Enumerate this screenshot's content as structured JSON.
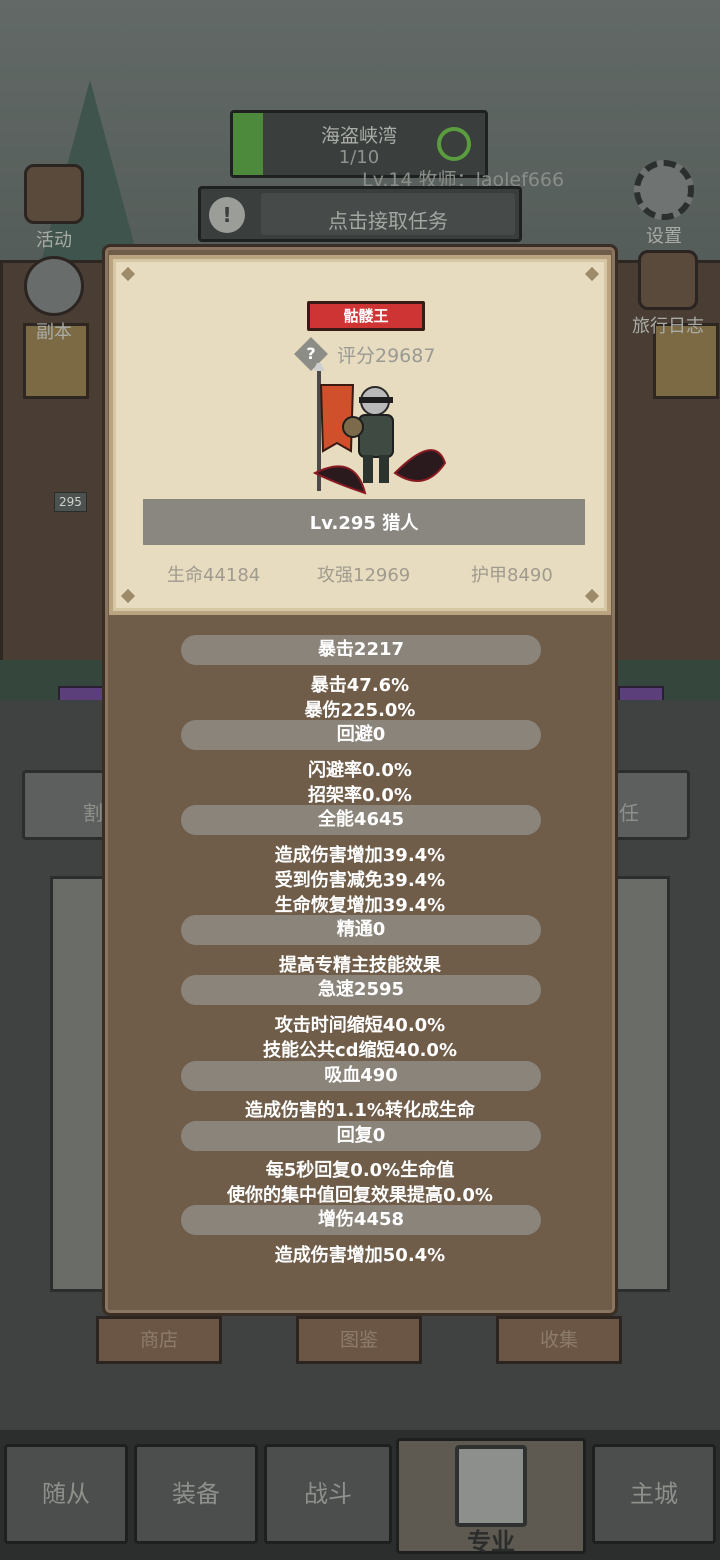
{
  "hud": {
    "quest_title": "海盗峡湾",
    "quest_count": "1/10",
    "player_info": "Lv.14 牧师：laolef666",
    "accept_task": "点击接取任务",
    "side_left": [
      "活动",
      "副本"
    ],
    "side_right": [
      "设置",
      "旅行日志"
    ],
    "small_level": "295"
  },
  "card": {
    "name": "骷髅王",
    "score": "评分29687",
    "level_class": "Lv.295 猎人",
    "hp": "生命44184",
    "attack": "攻强12969",
    "armor": "护甲8490"
  },
  "stats": {
    "crit": "暴击2217",
    "crit_rate": "暴击47.6%",
    "crit_dmg": "暴伤225.0%",
    "evade": "回避0",
    "dodge": "闪避率0.0%",
    "parry": "招架率0.0%",
    "versatility": "全能4645",
    "vers_dmg": "造成伤害增加39.4%",
    "vers_red": "受到伤害减免39.4%",
    "vers_heal": "生命恢复增加39.4%",
    "mastery": "精通0",
    "mastery_desc": "提高专精主技能效果",
    "haste": "急速2595",
    "haste_atk": "攻击时间缩短40.0%",
    "haste_cd": "技能公共cd缩短40.0%",
    "leech": "吸血490",
    "leech_desc": "造成伤害的1.1%转化成生命",
    "regen": "回复0",
    "regen_hp": "每5秒回复0.0%生命值",
    "regen_focus": "使你的集中值回复效果提高0.0%",
    "dmg_bonus": "增伤4458",
    "dmg_bonus_desc": "造成伤害增加50.4%"
  },
  "lower": {
    "tab_left": "割",
    "tab_right": "任",
    "buttons": [
      "商店",
      "图鉴",
      "收集"
    ]
  },
  "nav": {
    "items": [
      "随从",
      "装备",
      "战斗",
      "专业",
      "主城"
    ],
    "active": "专业"
  }
}
